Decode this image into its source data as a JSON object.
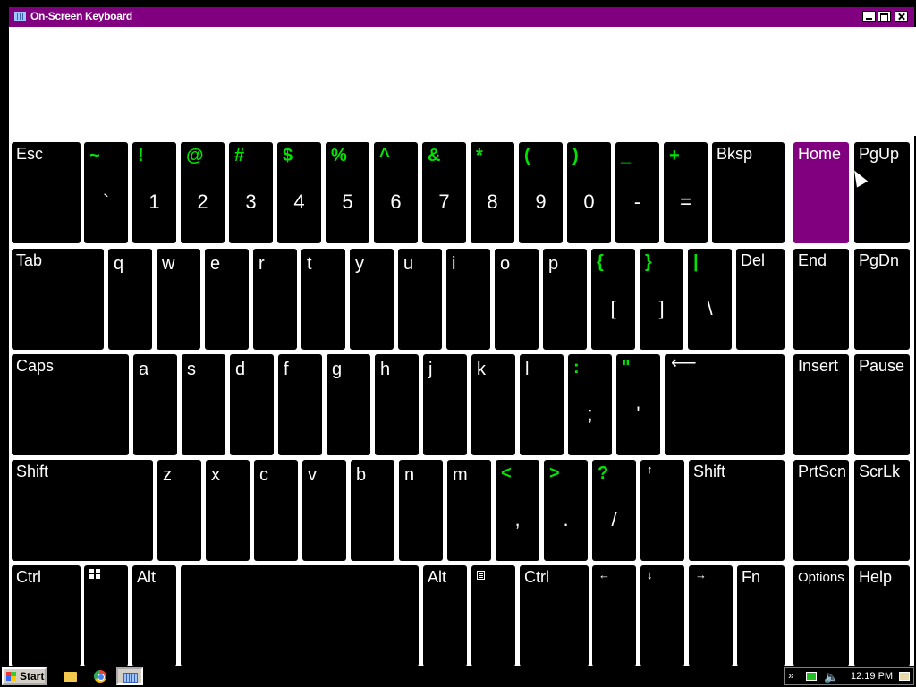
{
  "window": {
    "title": "On-Screen Keyboard"
  },
  "colors": {
    "titlebar": "#800080",
    "key_bg": "#000000",
    "key_active": "#800080",
    "shift_char": "#00e600",
    "label": "#ffffff"
  },
  "text_area": {
    "value": ""
  },
  "keyboard": {
    "row1": {
      "esc": "Esc",
      "num": [
        {
          "shift": "~",
          "base": "`"
        },
        {
          "shift": "!",
          "base": "1"
        },
        {
          "shift": "@",
          "base": "2"
        },
        {
          "shift": "#",
          "base": "3"
        },
        {
          "shift": "$",
          "base": "4"
        },
        {
          "shift": "%",
          "base": "5"
        },
        {
          "shift": "^",
          "base": "6"
        },
        {
          "shift": "&",
          "base": "7"
        },
        {
          "shift": "*",
          "base": "8"
        },
        {
          "shift": "(",
          "base": "9"
        },
        {
          "shift": ")",
          "base": "0"
        },
        {
          "shift": "_",
          "base": "-"
        },
        {
          "shift": "+",
          "base": "="
        }
      ],
      "bksp": "Bksp",
      "home": "Home",
      "pgup": "PgUp"
    },
    "row2": {
      "tab": "Tab",
      "letters": [
        "q",
        "w",
        "e",
        "r",
        "t",
        "y",
        "u",
        "i",
        "o",
        "p"
      ],
      "sym": [
        {
          "shift": "{",
          "base": "["
        },
        {
          "shift": "}",
          "base": "]"
        },
        {
          "shift": "|",
          "base": "\\"
        }
      ],
      "del": "Del",
      "end": "End",
      "pgdn": "PgDn"
    },
    "row3": {
      "caps": "Caps",
      "letters": [
        "a",
        "s",
        "d",
        "f",
        "g",
        "h",
        "j",
        "k",
        "l"
      ],
      "sym": [
        {
          "shift": ":",
          "base": ";"
        },
        {
          "shift": "\"",
          "base": "'"
        }
      ],
      "enter_icon": "enter-arrow",
      "enter_glyph": "⟵",
      "insert": "Insert",
      "pause": "Pause"
    },
    "row4": {
      "shift_left": "Shift",
      "letters": [
        "z",
        "x",
        "c",
        "v",
        "b",
        "n",
        "m"
      ],
      "sym": [
        {
          "shift": "<",
          "base": ","
        },
        {
          "shift": ">",
          "base": "."
        },
        {
          "shift": "?",
          "base": "/"
        }
      ],
      "up_glyph": "↑",
      "shift_right": "Shift",
      "prtscn": "PrtScn",
      "scrlk": "ScrLk"
    },
    "row5": {
      "ctrl_left": "Ctrl",
      "windows_icon": "windows-logo-icon",
      "alt_left": "Alt",
      "alt_right": "Alt",
      "menu_icon": "context-menu-icon",
      "ctrl_right": "Ctrl",
      "left_glyph": "←",
      "down_glyph": "↓",
      "right_glyph": "→",
      "fn": "Fn",
      "options": "Options",
      "help": "Help"
    }
  },
  "taskbar": {
    "start": "Start",
    "apps": [
      "folder-icon",
      "chrome-icon",
      "keyboard-icon"
    ],
    "tray": {
      "chevron": "»",
      "volume_glyph": "🔈",
      "clock": "12:19 PM"
    }
  }
}
